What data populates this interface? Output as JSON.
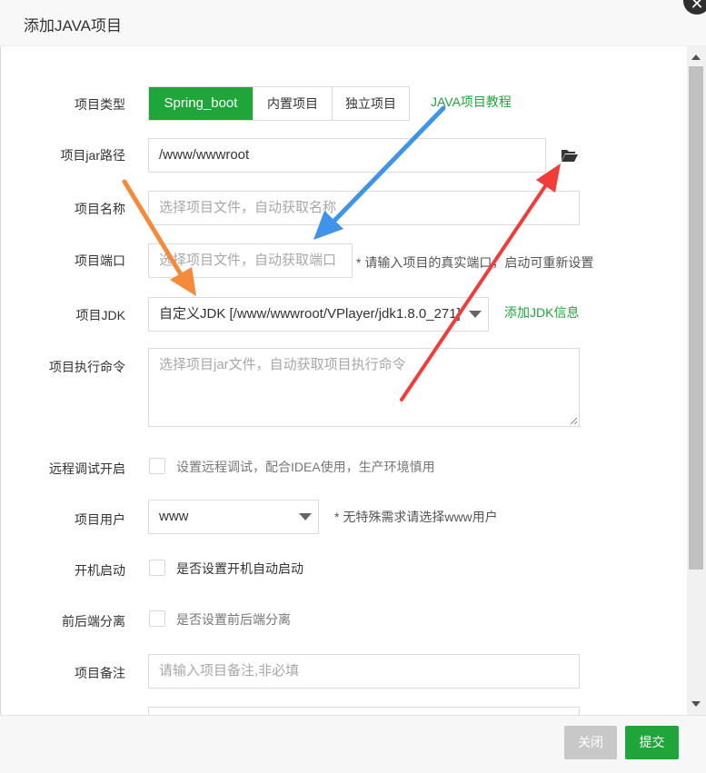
{
  "dialog": {
    "title": "添加JAVA项目",
    "close_glyph": "✕"
  },
  "form": {
    "project_type": {
      "label": "项目类型",
      "options": [
        "Spring_boot",
        "内置项目",
        "独立项目"
      ],
      "selected": "Spring_boot"
    },
    "tutorial_link": "JAVA项目教程",
    "jar_path": {
      "label": "项目jar路径",
      "value": "/www/wwwroot",
      "icon": "folder-open-icon"
    },
    "project_name": {
      "label": "项目名称",
      "placeholder": "选择项目文件，自动获取名称"
    },
    "project_port": {
      "label": "项目端口",
      "placeholder": "选择项目文件，自动获取端口",
      "hint": "* 请输入项目的真实端口，启动可重新设置"
    },
    "project_jdk": {
      "label": "项目JDK",
      "value": "自定义JDK [/www/wwwroot/VPlayer/jdk1.8.0_271]",
      "add_link": "添加JDK信息"
    },
    "exec_command": {
      "label": "项目执行命令",
      "placeholder": "选择项目jar文件，自动获取项目执行命令"
    },
    "remote_debug": {
      "label": "远程调试开启",
      "text": "设置远程调试，配合IDEA使用，生产环境慎用",
      "checked": false
    },
    "project_user": {
      "label": "项目用户",
      "value": "www",
      "hint": "* 无特殊需求请选择www用户"
    },
    "autostart": {
      "label": "开机启动",
      "text": "是否设置开机自动启动",
      "checked": false
    },
    "separation": {
      "label": "前后端分离",
      "text": "是否设置前后端分离",
      "checked": false
    },
    "project_note": {
      "label": "项目备注",
      "placeholder": "请输入项目备注,非必填"
    }
  },
  "footer": {
    "close_label": "关闭",
    "submit_label": "提交"
  },
  "colors": {
    "accent_green": "#20a53a",
    "arrow_blue": "#3d94e8",
    "arrow_orange": "#f58a3a",
    "arrow_red": "#f23c3c"
  }
}
